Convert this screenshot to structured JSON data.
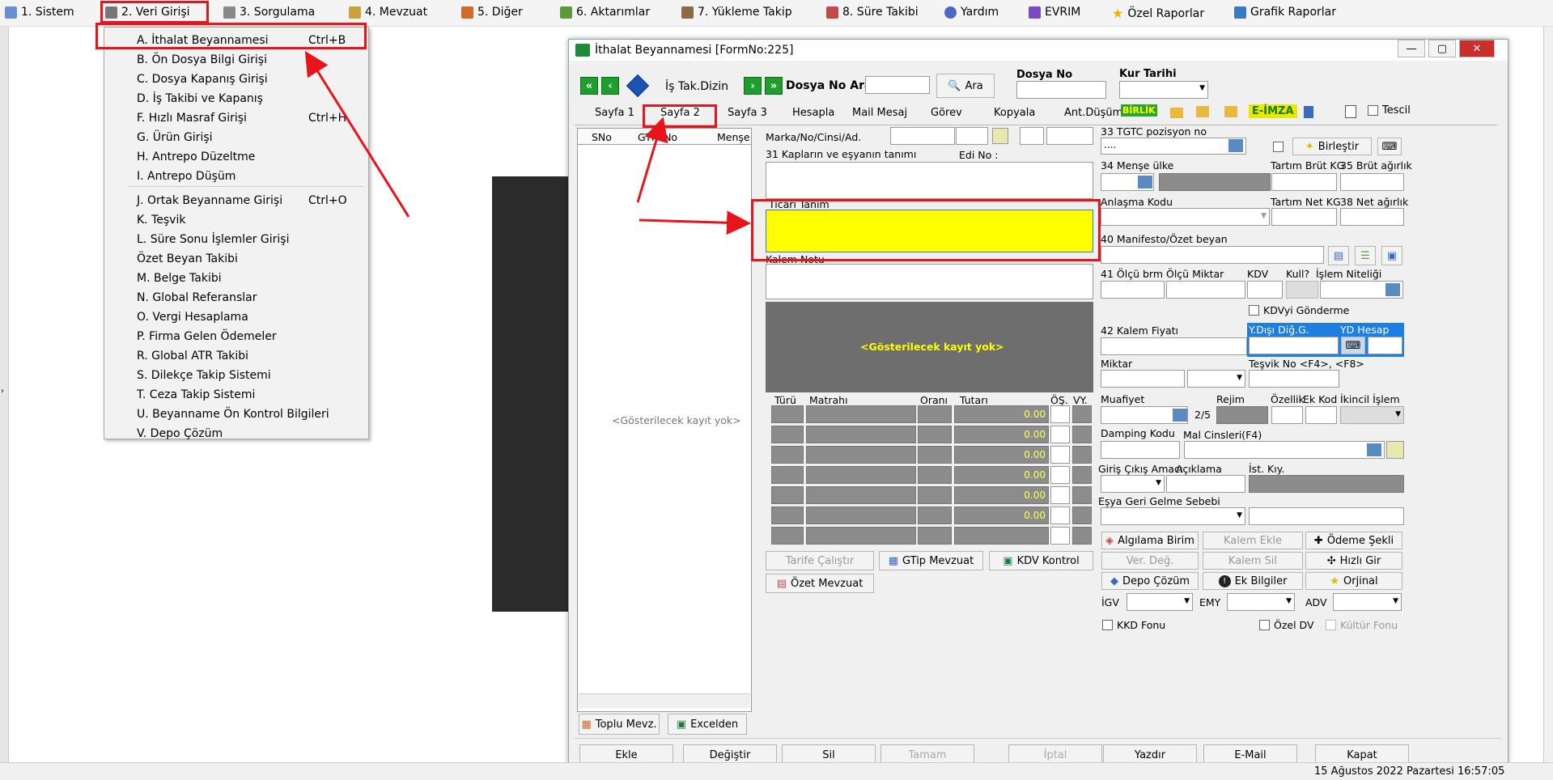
{
  "menu": {
    "m1": "1.  Sistem",
    "m2": "2.  Veri Girişi",
    "m3": "3.  Sorgulama",
    "m4": "4.  Mevzuat",
    "m5": "5.  Diğer",
    "m6": "6.  Aktarımlar",
    "m7": "7.  Yükleme Takip",
    "m8": "8. Süre Takibi",
    "m9": "Yardım",
    "m10": "EVRIM",
    "m11": "Özel Raporlar",
    "m12": "Grafik Raporlar"
  },
  "dropdown": {
    "items": [
      {
        "label": "A.  İthalat Beyannamesi",
        "key": "Ctrl+B"
      },
      {
        "label": "B.  Ön Dosya Bilgi Girişi",
        "key": ""
      },
      {
        "label": "C.  Dosya Kapanış Girişi",
        "key": ""
      },
      {
        "label": "D.  İş Takibi ve Kapanış",
        "key": ""
      },
      {
        "label": "F.  Hızlı Masraf Girişi",
        "key": "Ctrl+H"
      },
      {
        "label": "G.  Ürün Girişi",
        "key": ""
      },
      {
        "label": "H.  Antrepo Düzeltme",
        "key": ""
      },
      {
        "label": "I.   Antrepo Düşüm",
        "key": ""
      },
      {
        "label": "J.  Ortak Beyanname Girişi",
        "key": "Ctrl+O"
      },
      {
        "label": "K.  Teşvik",
        "key": ""
      },
      {
        "label": "L.  Süre Sonu İşlemler Girişi",
        "key": ""
      },
      {
        "label": "     Özet Beyan Takibi",
        "key": ""
      },
      {
        "label": "M.   Belge Takibi",
        "key": ""
      },
      {
        "label": "N.  Global Referanslar",
        "key": ""
      },
      {
        "label": "O. Vergi Hesaplama",
        "key": ""
      },
      {
        "label": "P. Firma Gelen Ödemeler",
        "key": ""
      },
      {
        "label": "R. Global ATR Takibi",
        "key": ""
      },
      {
        "label": "S. Dilekçe Takip Sistemi",
        "key": ""
      },
      {
        "label": "T. Ceza Takip Sistemi",
        "key": ""
      },
      {
        "label": "U. Beyanname Ön Kontrol Bilgileri",
        "key": ""
      },
      {
        "label": "V. Depo Çözüm",
        "key": ""
      }
    ]
  },
  "window": {
    "title": "İthalat Beyannamesi [FormNo:225]",
    "is_tak": "İş Tak.Dizin",
    "dosya_ara": "Dosya No Ara",
    "ara": "Ara",
    "dosya_no": "Dosya No",
    "kur": "Kur Tarihi"
  },
  "tabs": {
    "t1": "Sayfa 1",
    "t2": "Sayfa 2",
    "t3": "Sayfa 3",
    "t4": "Hesapla",
    "t5": "Mail Mesaj",
    "t6": "Görev",
    "t7": "Kopyala",
    "t8": "Ant.Düşüm",
    "birlik": "BİRLİK",
    "eimza": "E-İMZA",
    "tescil": "Tescil"
  },
  "left": {
    "c1": "SNo",
    "c2": "GTIP No",
    "c3": "Menşe",
    "empty": "<Gösterilecek kayıt yok>",
    "b1": "Toplu Mevz.",
    "b2": "Excelden"
  },
  "mid": {
    "l1": "Marka/No/Cinsi/Ad.",
    "l2": "31 Kapların ve eşyanın tanımı",
    "l3": "Edi No :",
    "l4": "Ticari Tanım",
    "l5": "Kalem Notu",
    "empty": "<Gösterilecek kayıt yok>",
    "h1": "Türü",
    "h2": "Matrahı",
    "h3": "Oranı",
    "h4": "Tutarı",
    "h5": "ÖŞ.",
    "h6": "VY.",
    "zero": "0.00",
    "b1": "Tarife Çalıştır",
    "b2": "GTip Mevzuat",
    "b3": "KDV Kontrol",
    "b4": "Özet Mevzuat"
  },
  "right": {
    "l33": "33 TGTC pozisyon no",
    "dots": "....",
    "birlestir": "Birleştir",
    "l34": "34 Menşe ülke",
    "tbk": "Tartım Brüt KG",
    "l35": "35 Brüt ağırlık",
    "ak": "Anlaşma Kodu",
    "tnk": "Tartım Net KG",
    "l38": "38 Net ağırlık",
    "l40": "40 Manifesto/Özet beyan",
    "l41": "41 Ölçü brm",
    "om": "Ölçü Miktar",
    "kdv": "KDV",
    "kull": "Kull?",
    "isn": "İşlem Niteliği",
    "kdvg": "KDVyi Gönderme",
    "l42": "42 Kalem Fiyatı",
    "ydd": "Y.Dışı Diğ.G.",
    "ydh": "YD Hesap",
    "miktar": "Miktar",
    "tesvik": "Teşvik No <F4>, <F8>",
    "muaf": "Muafiyet",
    "rate": "2/5",
    "rejim": "Rejim",
    "oz": "Özellik",
    "ek": "Ek Kod",
    "ik": "İkincil İşlem",
    "damp": "Damping Kodu",
    "mal": "Mal Cinsleri(F4)",
    "gca": "Giriş Çıkış Amacı",
    "acik": "Açıklama",
    "ist": "İst. Kıy.",
    "egs": "Eşya Geri Gelme Sebebi",
    "a1": "Algılama Birim",
    "a2": "Kalem Ekle",
    "a3": "Ödeme Şekli",
    "a4": "Ver. Değ.",
    "a5": "Kalem Sil",
    "a6": "Hızlı Gir",
    "a7": "Depo Çözüm",
    "a8": "Ek Bilgiler",
    "a9": "Orjinal",
    "igv": "İGV",
    "emy": "EMY",
    "adv": "ADV",
    "kkd": "KKD Fonu",
    "ozel": "Özel DV",
    "kultur": "Kültür Fonu"
  },
  "bottom": {
    "b1": "Ekle",
    "b2": "Değiştir",
    "b3": "Sil",
    "b4": "Tamam",
    "b5": "İptal",
    "b6": "Yazdır",
    "b7": "E-Mail",
    "b8": "Kapat"
  },
  "status": {
    "date": "15 Ağustos 2022 Pazartesi 16:57:05"
  }
}
